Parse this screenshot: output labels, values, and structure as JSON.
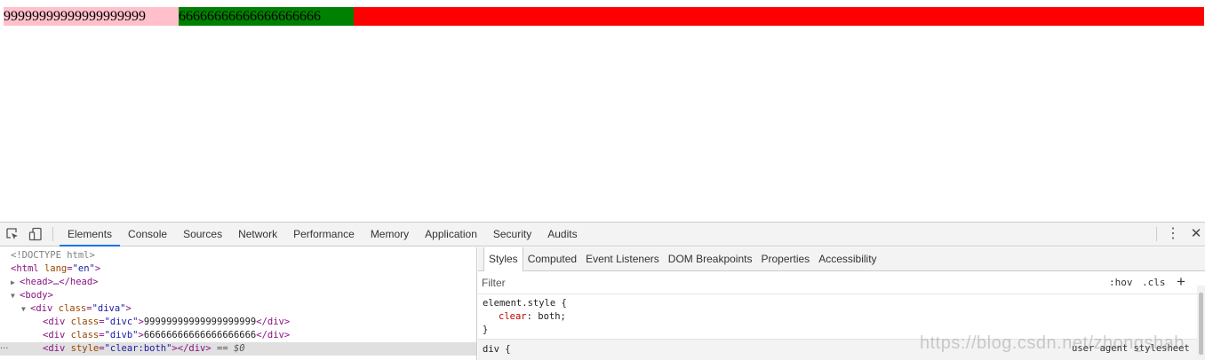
{
  "page": {
    "divc_text": "99999999999999999999",
    "divb_text": "66666666666666666666",
    "colors": {
      "diva": "#ff0000",
      "divc": "#ffc0cb",
      "divb": "#008000"
    }
  },
  "devtools": {
    "toolbar_icons": [
      "inspect-element-icon",
      "device-toolbar-icon"
    ],
    "tabs": [
      "Elements",
      "Console",
      "Sources",
      "Network",
      "Performance",
      "Memory",
      "Application",
      "Security",
      "Audits"
    ],
    "active_tab": "Elements",
    "more_icon": "⋮",
    "close_icon": "✕",
    "dom": {
      "doctype": "<!DOCTYPE html>",
      "html_open": "<html",
      "html_attr": "lang",
      "html_val": "\"en\"",
      "head": "<head>…</head>",
      "body_open": "<body>",
      "diva_tag": "<div",
      "diva_attr": "class",
      "diva_val": "\"diva\"",
      "divc_tag": "<div",
      "divc_attr": "class",
      "divc_val": "\"divc\"",
      "divc_text": "99999999999999999999",
      "divb_tag": "<div",
      "divb_attr": "class",
      "divb_val": "\"divb\"",
      "divb_text": "66666666666666666666",
      "clear_tag": "<div",
      "clear_attr": "style",
      "clear_val": "\"clear:both\"",
      "close_div": "</div>",
      "selected_marker": "== $0",
      "dots": "..."
    },
    "styles": {
      "subtabs": [
        "Styles",
        "Computed",
        "Event Listeners",
        "DOM Breakpoints",
        "Properties",
        "Accessibility"
      ],
      "active_subtab": "Styles",
      "filter_placeholder": "Filter",
      "hov": ":hov",
      "cls": ".cls",
      "plus": "+",
      "element_style_selector": "element.style {",
      "prop_name": "clear",
      "prop_value": ": both;",
      "close_brace": "}",
      "div_selector": "div {",
      "ua_label": "user agent stylesheet"
    }
  },
  "watermark": "https://blog.csdn.net/zhongshab"
}
